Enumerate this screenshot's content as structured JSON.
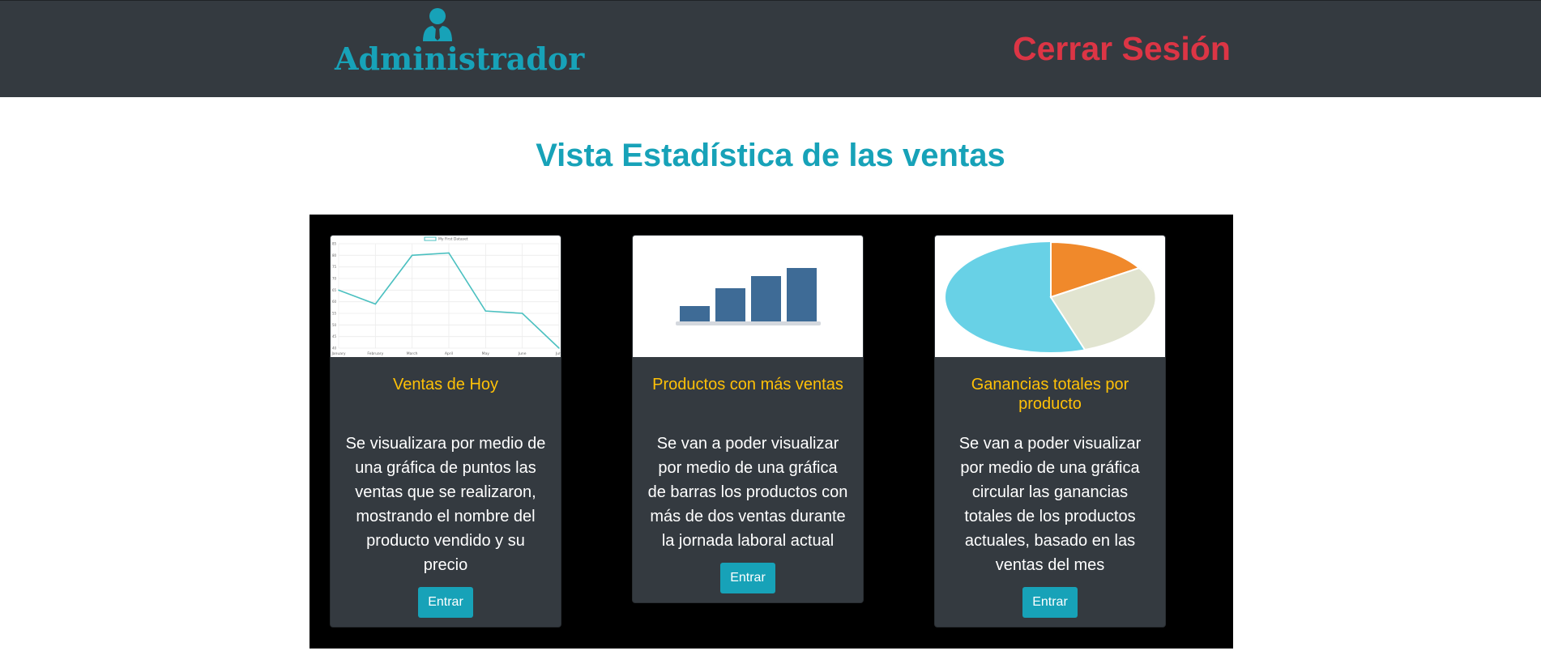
{
  "header": {
    "admin_label": "Administrador",
    "admin_icon": "user-tie-icon",
    "logout_label": "Cerrar Sesión"
  },
  "main": {
    "title": "Vista Estadística de las ventas"
  },
  "cards": [
    {
      "image": "line-chart-thumbnail",
      "title": "Ventas de Hoy",
      "text": "Se visualizara por medio de una gráfica de puntos las ventas que se realizaron, mostrando el nombre del producto vendido y su precio",
      "button_label": "Entrar"
    },
    {
      "image": "bar-chart-icon",
      "title": "Productos con más ventas",
      "text": "Se van a poder visualizar por medio de una gráfica de barras los productos con más de dos ventas durante la jornada laboral actual",
      "button_label": "Entrar"
    },
    {
      "image": "pie-chart-icon",
      "title": "Ganancias totales por producto",
      "text": "Se van a poder visualizar por medio de una gráfica circular las ganancias totales de los productos actuales, basado en las ventas del mes",
      "button_label": "Entrar"
    }
  ],
  "thumb_line_chart": {
    "legend": "My First Dataset",
    "labels": [
      "January",
      "February",
      "March",
      "April",
      "May",
      "June",
      "July"
    ],
    "values": [
      65,
      59,
      80,
      81,
      56,
      55,
      40
    ],
    "ylim": [
      40,
      85
    ],
    "yticks": [
      "40",
      "45",
      "50",
      "55",
      "60",
      "65",
      "70",
      "75",
      "80",
      "85"
    ],
    "color": "#4bc0c0"
  },
  "colors": {
    "navbar": "#343a40",
    "accent": "#17a2b8",
    "danger": "#dc3545",
    "warning": "#ffc107"
  }
}
